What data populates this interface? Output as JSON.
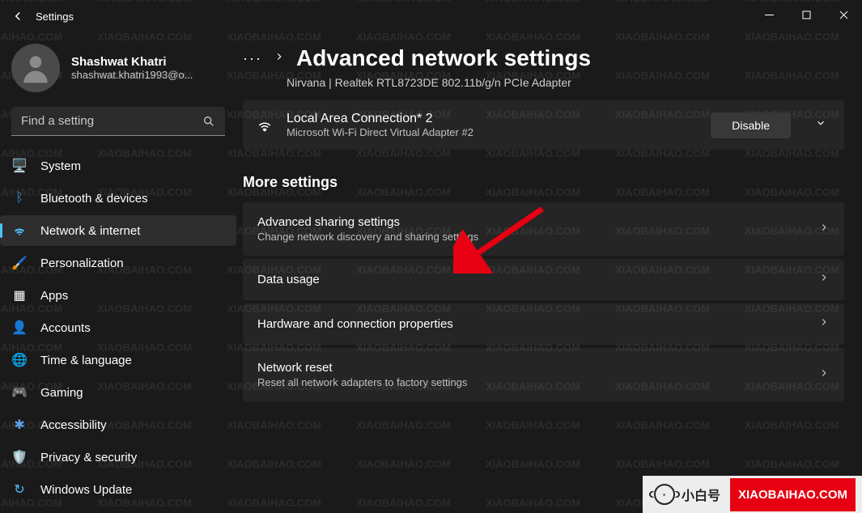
{
  "titlebar": {
    "title": "Settings"
  },
  "profile": {
    "name": "Shashwat Khatri",
    "email": "shashwat.khatri1993@o..."
  },
  "search": {
    "placeholder": "Find a setting"
  },
  "nav": {
    "items": [
      {
        "label": "System"
      },
      {
        "label": "Bluetooth & devices"
      },
      {
        "label": "Network & internet"
      },
      {
        "label": "Personalization"
      },
      {
        "label": "Apps"
      },
      {
        "label": "Accounts"
      },
      {
        "label": "Time & language"
      },
      {
        "label": "Gaming"
      },
      {
        "label": "Accessibility"
      },
      {
        "label": "Privacy & security"
      },
      {
        "label": "Windows Update"
      }
    ]
  },
  "page": {
    "title": "Advanced network settings",
    "adapter1": {
      "desc": "Nirvana | Realtek RTL8723DE 802.11b/g/n PCIe Adapter"
    },
    "adapter2": {
      "name": "Local Area Connection* 2",
      "desc": "Microsoft Wi-Fi Direct Virtual Adapter #2",
      "button": "Disable"
    },
    "more_heading": "More settings",
    "cards": [
      {
        "title": "Advanced sharing settings",
        "desc": "Change network discovery and sharing settings"
      },
      {
        "title": "Data usage",
        "desc": ""
      },
      {
        "title": "Hardware and connection properties",
        "desc": ""
      },
      {
        "title": "Network reset",
        "desc": "Reset all network adapters to factory settings"
      }
    ]
  },
  "watermark": {
    "text": "XIAOBAIHAO.COM",
    "logo1": "小白号",
    "logo2": "XIAOBAIHAO.COM"
  }
}
